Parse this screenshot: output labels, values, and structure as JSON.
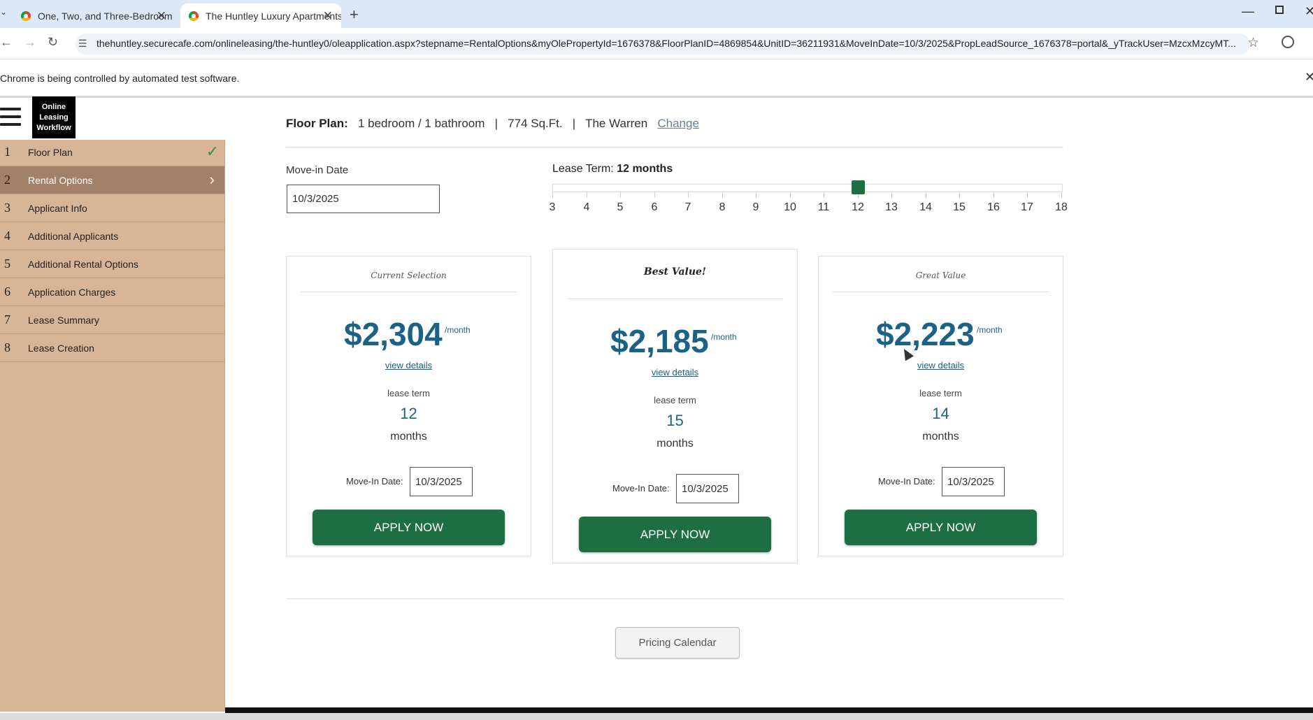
{
  "browser": {
    "tabs": [
      {
        "title": "One, Two, and Three-Bedroom"
      },
      {
        "title": "The Huntley Luxury Apartments"
      }
    ],
    "url": "thehuntley.securecafe.com/onlineleasing/the-huntley0/oleapplication.aspx?stepname=RentalOptions&myOlePropertyId=1676378&FloorPlanID=4869854&UnitID=36211931&MoveInDate=10/3/2025&PropLeadSource_1676378=portal&_yTrackUser=MzcxMzcyMT...",
    "infobar_text": "Chrome is being controlled by automated test software."
  },
  "sidebar": {
    "badge_lines": [
      "Online",
      "Leasing",
      "Workflow"
    ],
    "steps": [
      {
        "num": "1",
        "label": "Floor Plan",
        "state": "complete"
      },
      {
        "num": "2",
        "label": "Rental Options",
        "state": "active"
      },
      {
        "num": "3",
        "label": "Applicant Info"
      },
      {
        "num": "4",
        "label": "Additional Applicants"
      },
      {
        "num": "5",
        "label": "Additional Rental Options"
      },
      {
        "num": "6",
        "label": "Application Charges"
      },
      {
        "num": "7",
        "label": "Lease Summary"
      },
      {
        "num": "8",
        "label": "Lease Creation"
      }
    ]
  },
  "floor_plan": {
    "label": "Floor Plan:",
    "beds_baths": "1 bedroom / 1 bathroom",
    "sep": "|",
    "sqft": "774 Sq.Ft.",
    "name": "The Warren",
    "change_link": "Change"
  },
  "move_in": {
    "label": "Move-in Date",
    "value": "10/3/2025"
  },
  "lease_term": {
    "label": "Lease Term:",
    "value": "12 months",
    "selected": 12,
    "ticks": [
      "3",
      "4",
      "5",
      "6",
      "7",
      "8",
      "9",
      "10",
      "11",
      "12",
      "13",
      "14",
      "15",
      "16",
      "17",
      "18"
    ]
  },
  "cards": [
    {
      "badge": "Current Selection",
      "price": "$2,304",
      "per": "/month",
      "details": "view details",
      "term_label": "lease term",
      "term": "12",
      "months": "months",
      "move_in_label": "Move-In Date:",
      "move_in_value": "10/3/2025",
      "apply": "APPLY NOW"
    },
    {
      "badge": "Best Value!",
      "price": "$2,185",
      "per": "/month",
      "details": "view details",
      "term_label": "lease term",
      "term": "15",
      "months": "months",
      "move_in_label": "Move-In Date:",
      "move_in_value": "10/3/2025",
      "apply": "APPLY NOW"
    },
    {
      "badge": "Great Value",
      "price": "$2,223",
      "per": "/month",
      "details": "view details",
      "term_label": "lease term",
      "term": "14",
      "months": "months",
      "move_in_label": "Move-In Date:",
      "move_in_value": "10/3/2025",
      "apply": "APPLY NOW"
    }
  ],
  "pricing_calendar": "Pricing Calendar",
  "colors": {
    "accent_green": "#1e6e44",
    "price_blue": "#1c6186",
    "sidebar_bg": "#d8b596",
    "sidebar_active": "#a2806a"
  }
}
